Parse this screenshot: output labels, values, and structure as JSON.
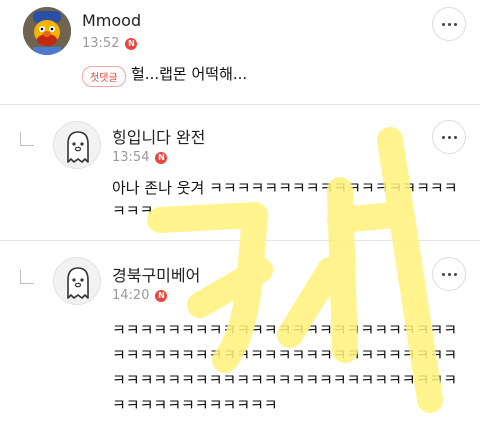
{
  "comments": [
    {
      "author": "Mmood",
      "time": "13:52",
      "new_badge": "N",
      "tag": "첫댓글",
      "text": "헐...랩몬 어떡해..."
    },
    {
      "author": "힝입니다 완전",
      "time": "13:54",
      "new_badge": "N",
      "text": "아나 존나 웃겨 ㅋㅋㅋㅋㅋㅋㅋㅋㅋㅋㅋㅋㅋㅋㅋㅋㅋㅋㅋㅋㅋ"
    },
    {
      "author": "경북구미베어",
      "time": "14:20",
      "new_badge": "N",
      "text": "ㅋㅋㅋㅋㅋㅋㅋㅋㅋㅋㅋㅋㅋㅋㅋㅋㅋㅋㅋㅋㅋㅋㅋㅋㅋㅋㅋㅋㅋㅋㅋㅋㅋㅋㅋㅋㅋㅋㅋㅋㅋㅋㅋㅋㅋㅋㅋㅋㅋㅋㅋㅋㅋㅋㅋㅋㅋㅋㅋㅋㅋㅋㅋㅋㅋㅋㅋㅋㅋㅋㅋㅋㅋㅋㅋㅋㅋㅋㅋㅋㅋㅋㅋㅋㅋㅋㅋ"
    }
  ],
  "icons": {
    "more": "more-options-icon",
    "reply": "reply-indicator-icon",
    "ghost_avatar": "default-avatar-icon"
  },
  "colors": {
    "new_badge": "#e8463f",
    "tag_text": "#e8463f",
    "watermark": "#fff27a"
  }
}
